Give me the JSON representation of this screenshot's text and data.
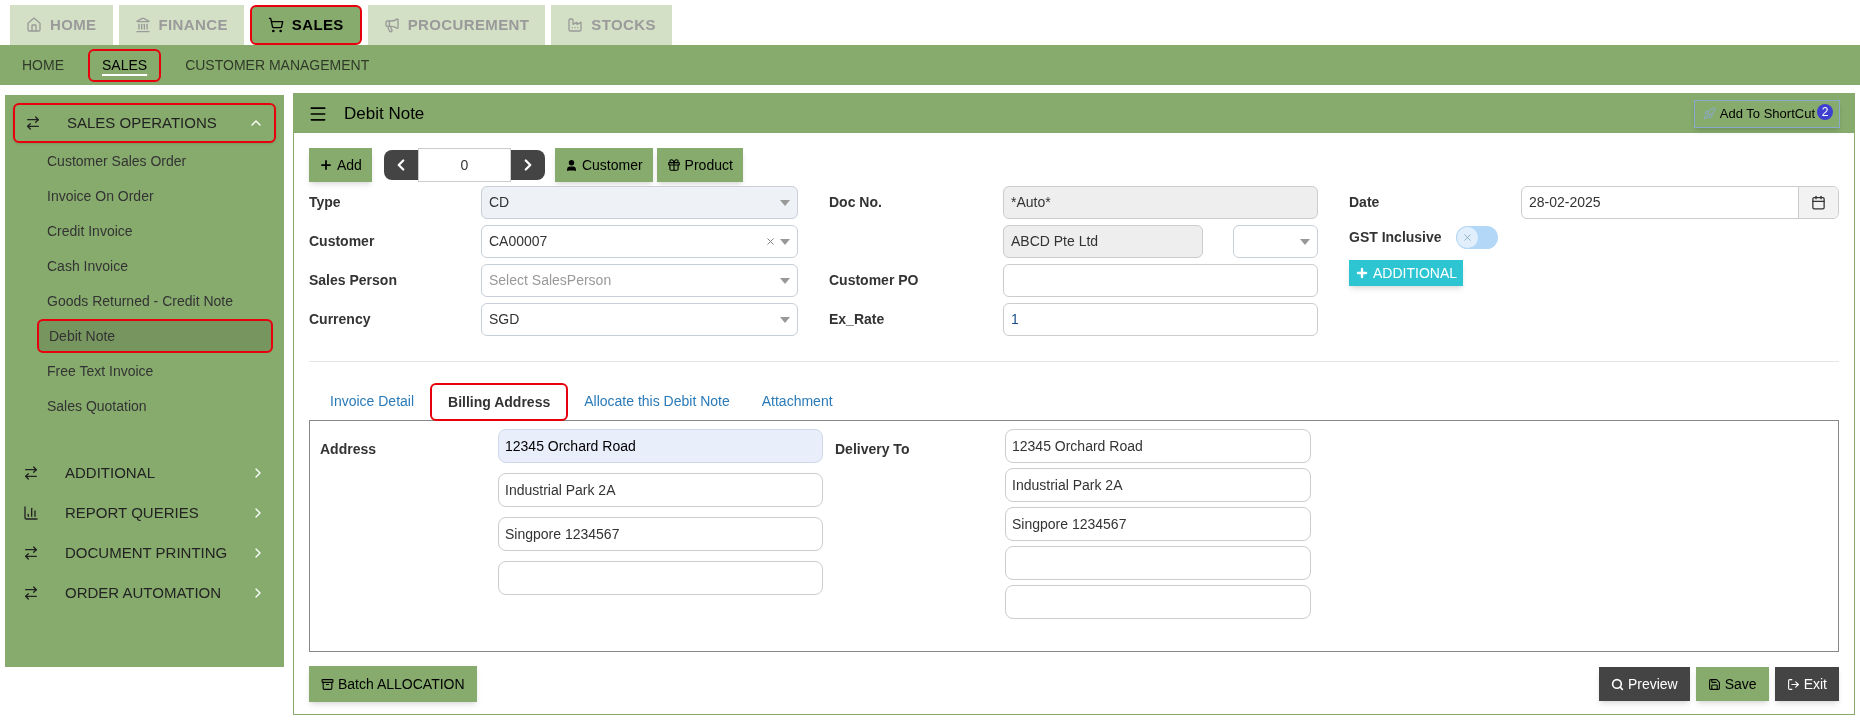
{
  "top_tabs": [
    {
      "label": "HOME",
      "selected": false
    },
    {
      "label": "FINANCE",
      "selected": false
    },
    {
      "label": "SALES",
      "selected": true
    },
    {
      "label": "PROCUREMENT",
      "selected": false
    },
    {
      "label": "STOCKS",
      "selected": false
    }
  ],
  "sub_nav": [
    {
      "label": "HOME",
      "selected": false
    },
    {
      "label": "SALES",
      "selected": true
    },
    {
      "label": "CUSTOMER MANAGEMENT",
      "selected": false
    }
  ],
  "sidebar": {
    "groups": [
      {
        "label": "SALES OPERATIONS",
        "kind": "arrows",
        "expanded": true,
        "selected": true,
        "items": [
          {
            "label": "Customer Sales Order",
            "selected": false
          },
          {
            "label": "Invoice On Order",
            "selected": false
          },
          {
            "label": "Credit Invoice",
            "selected": false
          },
          {
            "label": "Cash Invoice",
            "selected": false
          },
          {
            "label": "Goods Returned - Credit Note",
            "selected": false
          },
          {
            "label": "Debit Note",
            "selected": true
          },
          {
            "label": "Free Text Invoice",
            "selected": false
          },
          {
            "label": "Sales Quotation",
            "selected": false
          }
        ]
      },
      {
        "label": "ADDITIONAL",
        "kind": "arrows",
        "expanded": false,
        "selected": false
      },
      {
        "label": "REPORT QUERIES",
        "kind": "chart",
        "expanded": false,
        "selected": false
      },
      {
        "label": "DOCUMENT PRINTING",
        "kind": "arrows",
        "expanded": false,
        "selected": false
      },
      {
        "label": "ORDER AUTOMATION",
        "kind": "arrows",
        "expanded": false,
        "selected": false
      }
    ]
  },
  "page": {
    "title": "Debit Note",
    "shortcut": {
      "label": "Add To ShortCut",
      "badge": "2"
    }
  },
  "toolbar": {
    "add": "Add",
    "record": "0",
    "customer": "Customer",
    "product": "Product"
  },
  "form": {
    "left": [
      {
        "label": "Type",
        "value": "CD",
        "disabled": true,
        "clearable": false
      },
      {
        "label": "Customer",
        "value": "CA00007",
        "disabled": false,
        "clearable": true
      },
      {
        "label": "Sales Person",
        "placeholder": "Select SalesPerson",
        "disabled": false,
        "clearable": false
      },
      {
        "label": "Currency",
        "value": "SGD",
        "disabled": false,
        "clearable": false
      }
    ],
    "middle": [
      {
        "label": "Doc No.",
        "value": "*Auto*",
        "kind": "readonly"
      },
      {
        "value": "ABCD Pte Ltd",
        "kind": "readonly_select"
      },
      {
        "label": "Customer PO",
        "kind": "input"
      },
      {
        "label": "Ex_Rate",
        "value": "1",
        "kind": "input"
      }
    ],
    "date": {
      "label": "Date",
      "value": "28-02-2025"
    },
    "gst": {
      "label": "GST Inclusive",
      "on": false
    },
    "additional": "ADDITIONAL"
  },
  "tabs": [
    {
      "label": "Invoice Detail",
      "selected": false
    },
    {
      "label": "Billing Address",
      "selected": true
    },
    {
      "label": "Allocate this Debit Note",
      "selected": false
    },
    {
      "label": "Attachment",
      "selected": false
    }
  ],
  "billing": {
    "address_label": "Address",
    "address_lines": [
      {
        "value": "12345 Orchard Road",
        "focused": true
      },
      {
        "value": "Industrial Park 2A",
        "focused": false
      },
      {
        "value": "Singpore 1234567",
        "focused": false
      },
      {
        "focused": false
      }
    ],
    "delivery_label": "Delivery To",
    "delivery_lines": [
      {
        "value": "12345 Orchard Road",
        "focused": false
      },
      {
        "value": "Industrial Park 2A",
        "focused": false
      },
      {
        "value": "Singpore 1234567",
        "focused": false
      },
      {
        "focused": false
      },
      {
        "focused": false
      }
    ]
  },
  "footer": {
    "batch": "Batch ALLOCATION",
    "preview": "Preview",
    "save": "Save",
    "exit": "Exit"
  }
}
